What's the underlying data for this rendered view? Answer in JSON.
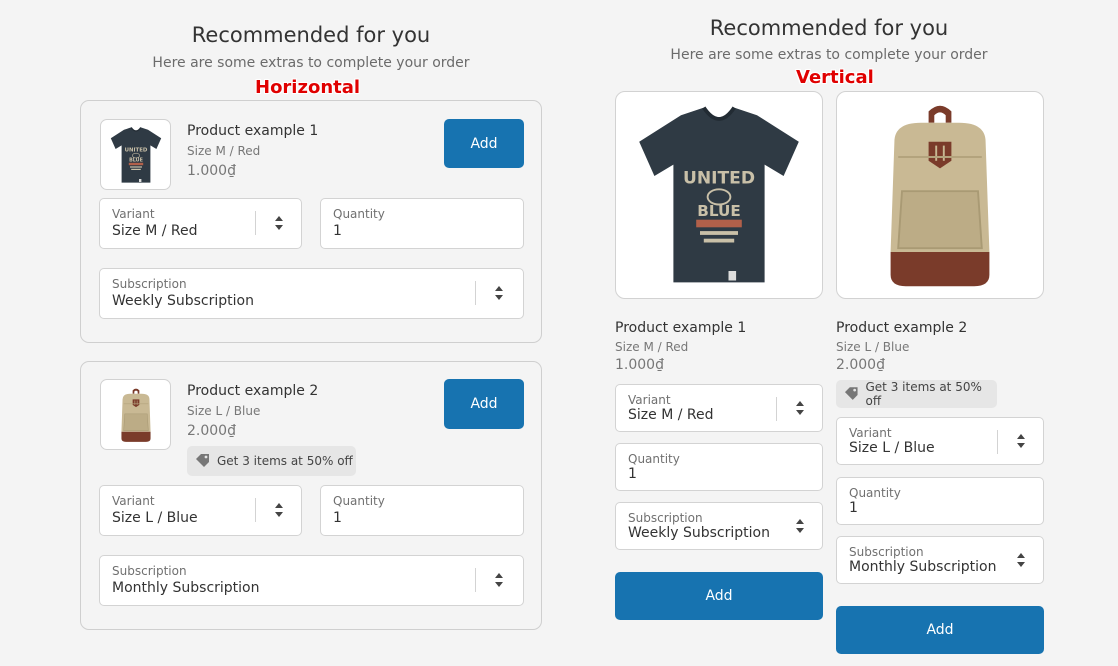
{
  "horizontal": {
    "title": "Recommended for you",
    "subtitle": "Here are some extras to complete your order",
    "annotation": "Horizontal",
    "products": [
      {
        "name": "Product example 1",
        "variant_text": "Size M / Red",
        "price": "1.000₫",
        "add_label": "Add",
        "variant_label": "Variant",
        "variant_value": "Size M / Red",
        "quantity_label": "Quantity",
        "quantity_value": "1",
        "subscription_label": "Subscription",
        "subscription_value": "Weekly Subscription"
      },
      {
        "name": "Product example 2",
        "variant_text": "Size L / Blue",
        "price": "2.000₫",
        "badge": "Get 3 items at 50% off",
        "add_label": "Add",
        "variant_label": "Variant",
        "variant_value": "Size L / Blue",
        "quantity_label": "Quantity",
        "quantity_value": "1",
        "subscription_label": "Subscription",
        "subscription_value": "Monthly Subscription"
      }
    ]
  },
  "vertical": {
    "title": "Recommended for you",
    "subtitle": "Here are some extras to complete your order",
    "annotation": "Vertical",
    "products": [
      {
        "name": "Product example 1",
        "variant_text": "Size M / Red",
        "price": "1.000₫",
        "variant_label": "Variant",
        "variant_value": "Size M / Red",
        "quantity_label": "Quantity",
        "quantity_value": "1",
        "subscription_label": "Subscription",
        "subscription_value": "Weekly Subscription",
        "add_label": "Add"
      },
      {
        "name": "Product example 2",
        "variant_text": "Size L / Blue",
        "price": "2.000₫",
        "badge": "Get 3 items at 50% off",
        "variant_label": "Variant",
        "variant_value": "Size L / Blue",
        "quantity_label": "Quantity",
        "quantity_value": "1",
        "subscription_label": "Subscription",
        "subscription_value": "Monthly Subscription",
        "add_label": "Add"
      }
    ]
  },
  "colors": {
    "accent": "#1773b0",
    "annotation": "#e00000"
  },
  "images": {
    "product_1": "tshirt-image",
    "product_2": "backpack-image"
  }
}
